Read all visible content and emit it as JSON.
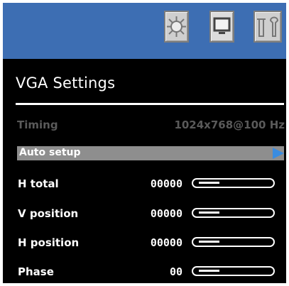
{
  "toolbar": {
    "icons": [
      "brightness-icon",
      "monitor-icon",
      "tools-icon"
    ]
  },
  "title": "VGA Settings",
  "timing": {
    "label": "Timing",
    "value": "1024x768@100 Hz"
  },
  "auto_setup": {
    "label": "Auto setup"
  },
  "rows": [
    {
      "label": "H total",
      "value": "00000",
      "level": 0.3
    },
    {
      "label": "V position",
      "value": "00000",
      "level": 0.3
    },
    {
      "label": "H position",
      "value": "00000",
      "level": 0.3
    },
    {
      "label": "Phase",
      "value": "00",
      "level": 0.3
    }
  ],
  "colors": {
    "top_bar": "#3d6eb3",
    "background": "#000000",
    "highlight": "#8e8e8e",
    "arrow": "#3a8ce0",
    "disabled_text": "#5a5a5a"
  }
}
